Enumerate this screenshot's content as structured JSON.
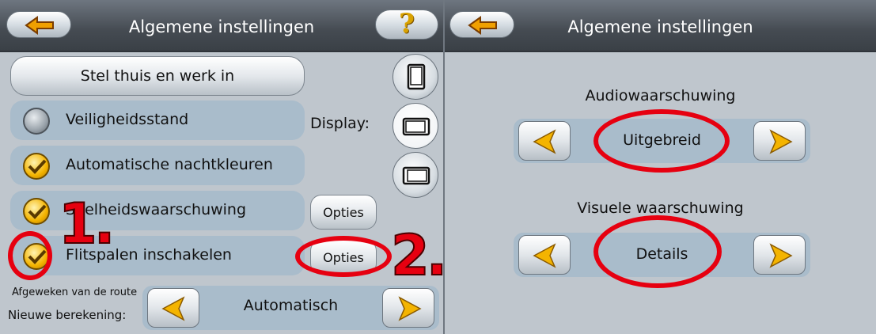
{
  "left": {
    "title": "Algemene instellingen",
    "help_symbol": "?",
    "home_work_button": "Stel thuis en werk in",
    "display_label": "Display:",
    "rows": [
      {
        "label": "Veiligheidsstand",
        "checked": false
      },
      {
        "label": "Automatische nachtkleuren",
        "checked": true
      },
      {
        "label": "Snelheidswaarschuwing",
        "checked": true,
        "options": "Opties"
      },
      {
        "label": "Flitspalen inschakelen",
        "checked": true,
        "options": "Opties"
      }
    ],
    "route_label_line1": "Afgeweken van de route",
    "route_label_line2": "Nieuwe berekening:",
    "route_value": "Automatisch"
  },
  "right": {
    "title": "Algemene instellingen",
    "audio_label": "Audiowaarschuwing",
    "audio_value": "Uitgebreid",
    "visual_label": "Visuele waarschuwing",
    "visual_value": "Details"
  },
  "annotations": {
    "step1": "1.",
    "step2": "2."
  },
  "colors": {
    "accent": "#f4b400",
    "annotation": "#e60010",
    "row_bg": "#a9bccb"
  }
}
